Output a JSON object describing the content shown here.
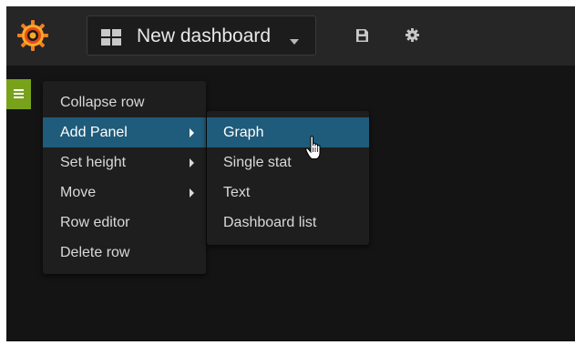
{
  "navbar": {
    "logo_icon": "grafana-logo",
    "dashboard_title": "New dashboard",
    "dashboard_icon": "grid-icon",
    "caret_icon": "caret-down-icon",
    "save_icon": "save-icon",
    "settings_icon": "gear-icon"
  },
  "row": {
    "toggle_icon": "hamburger-icon",
    "toggle_color": "#78a21b"
  },
  "row_menu": {
    "items": [
      {
        "label": "Collapse row",
        "has_submenu": false,
        "active": false
      },
      {
        "label": "Add Panel",
        "has_submenu": true,
        "active": true
      },
      {
        "label": "Set height",
        "has_submenu": true,
        "active": false
      },
      {
        "label": "Move",
        "has_submenu": true,
        "active": false
      },
      {
        "label": "Row editor",
        "has_submenu": false,
        "active": false
      },
      {
        "label": "Delete row",
        "has_submenu": false,
        "active": false
      }
    ]
  },
  "panel_submenu": {
    "items": [
      {
        "label": "Graph",
        "active": true
      },
      {
        "label": "Single stat",
        "active": false
      },
      {
        "label": "Text",
        "active": false
      },
      {
        "label": "Dashboard list",
        "active": false
      }
    ]
  },
  "colors": {
    "background": "#141414",
    "navbar": "#262626",
    "menu": "#1e1e1e",
    "active_item": "#1f5b7a",
    "text": "#d8d9da"
  }
}
